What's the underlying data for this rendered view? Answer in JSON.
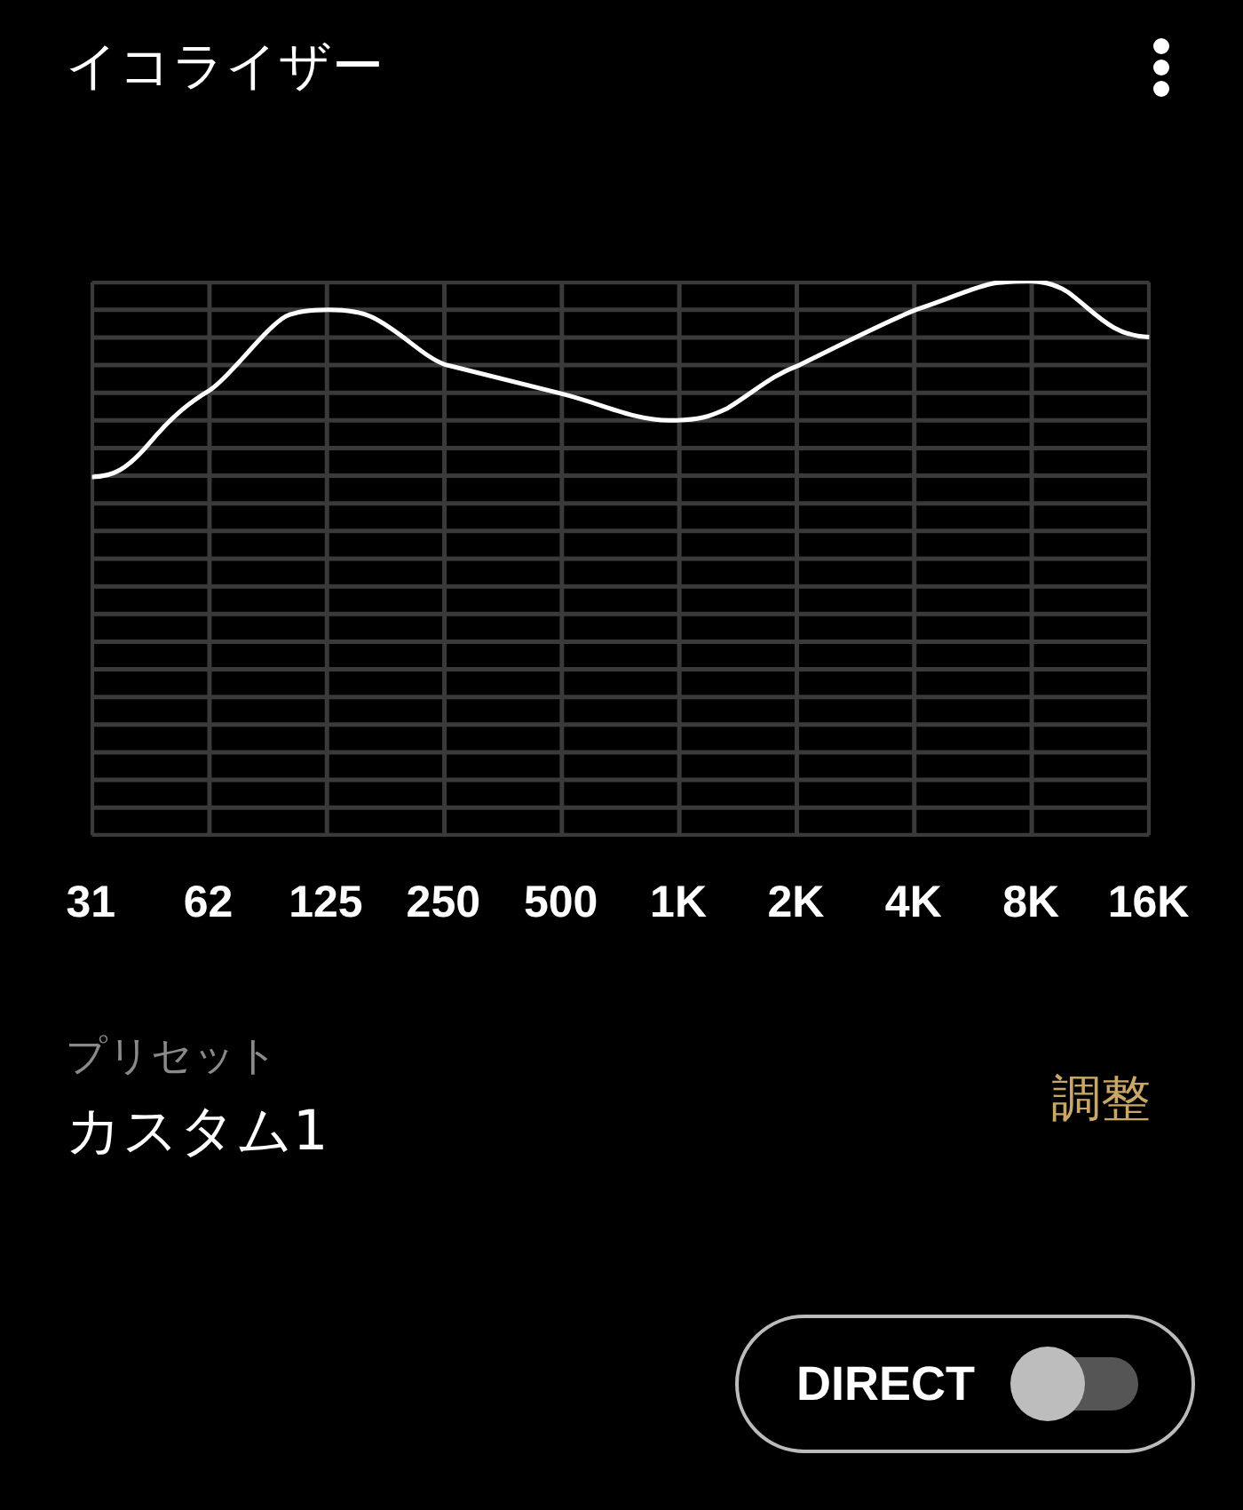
{
  "title": "イコライザー",
  "equalizer": {
    "bands": [
      "31",
      "62",
      "125",
      "250",
      "500",
      "1K",
      "2K",
      "4K",
      "8K",
      "16K"
    ]
  },
  "preset": {
    "label": "プリセット",
    "value": "カスタム1"
  },
  "adjust_button": "調整",
  "direct": {
    "label": "DIRECT",
    "on": false
  }
}
